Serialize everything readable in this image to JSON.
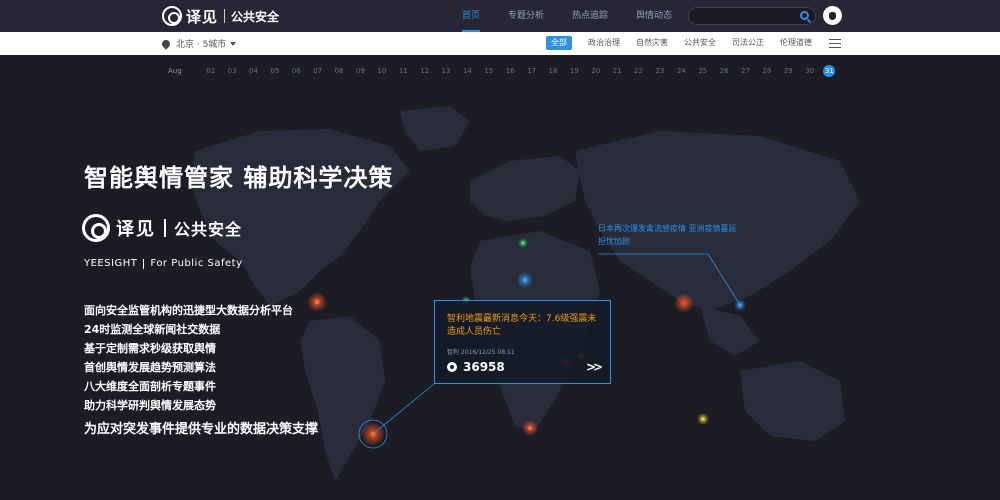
{
  "topnav": {
    "logo_text": "译见",
    "logo_sub": "公共安全",
    "links": [
      "首页",
      "专题分析",
      "热点追踪",
      "舆情动态"
    ],
    "search_placeholder": ""
  },
  "subbar": {
    "location": "北京 · 5城市",
    "categories": [
      "全部",
      "政治治理",
      "自然灾害",
      "公共安全",
      "司法公正",
      "伦理道德"
    ]
  },
  "timeline": {
    "month": "Aug",
    "days": [
      "02",
      "03",
      "04",
      "05",
      "06",
      "07",
      "08",
      "09",
      "10",
      "11",
      "12",
      "13",
      "14",
      "15",
      "16",
      "17",
      "18",
      "19",
      "20",
      "21",
      "22",
      "23",
      "24",
      "25",
      "26",
      "27",
      "28",
      "29",
      "30",
      "31"
    ],
    "active_day": "31"
  },
  "hero": {
    "headline": "智能舆情管家  辅助科学决策",
    "brand_name": "译见",
    "brand_sub": "公共安全",
    "brand_en_name": "YEESIGHT",
    "brand_en_sub": "For Public Safety",
    "features": [
      "面向安全监管机构的迅捷型大数据分析平台",
      "24时监测全球新闻社交数据",
      "基于定制需求秒级获取舆情",
      "首创舆情发展趋势预测算法",
      "八大维度全面剖析专题事件",
      "助力科学研判舆情发展态势"
    ],
    "tagline": "为应对突发事件提供专业的数据决策支撑"
  },
  "popup": {
    "title": "智利地震最新消息今天：7.6级强震未造成人员伤亡",
    "meta": "智利  2016/12/25 08:11",
    "count": "36958"
  },
  "note": {
    "text": "日本再次爆发禽流感疫情 亚洲疫情蔓延担忧加剧"
  },
  "colors": {
    "accent": "#2d8fe6",
    "alert": "#f39c12",
    "hotspot": "#e8411f"
  }
}
